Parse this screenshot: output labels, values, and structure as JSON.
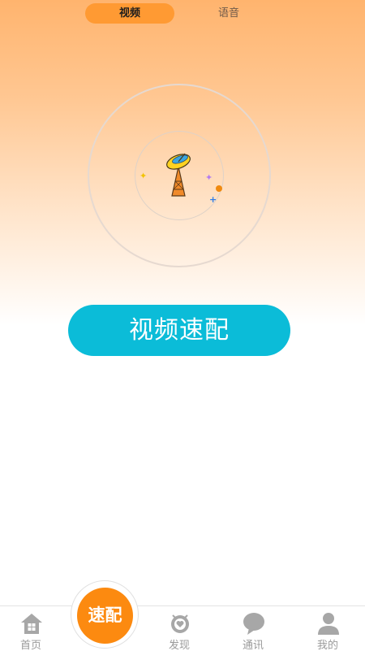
{
  "mode_switch": {
    "tabs": [
      {
        "label": "视频",
        "selected": true
      },
      {
        "label": "语音",
        "selected": false
      }
    ]
  },
  "radar": {
    "icon": "satellite-dish-icon"
  },
  "main": {
    "match_button_label": "视频速配"
  },
  "tabbar": {
    "items": [
      {
        "label": "首页",
        "icon": "home-icon"
      },
      {
        "label": "发现",
        "icon": "discover-icon"
      },
      {
        "label": "通讯",
        "icon": "chat-bubble-icon"
      },
      {
        "label": "我的",
        "icon": "person-icon"
      }
    ],
    "center_label": "速配"
  },
  "colors": {
    "accent": "#ff9a33",
    "button": "#0bbcd8",
    "fab": "#fc8a10"
  }
}
